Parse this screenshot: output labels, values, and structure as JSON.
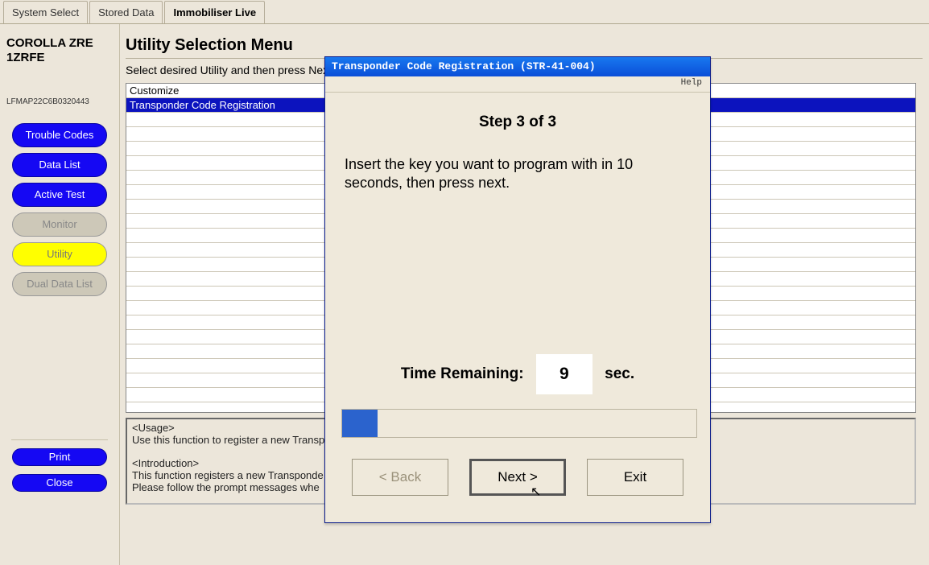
{
  "tabs": {
    "system_select": "System Select",
    "stored_data": "Stored Data",
    "immobiliser_live": "Immobiliser Live"
  },
  "sidebar": {
    "vehicle": "COROLLA ZRE 1ZRFE",
    "map_id": "LFMAP22C6B0320443",
    "buttons": {
      "trouble_codes": "Trouble Codes",
      "data_list": "Data List",
      "active_test": "Active Test",
      "monitor": "Monitor",
      "utility": "Utility",
      "dual_data_list": "Dual Data List"
    },
    "footer": {
      "print": "Print",
      "close": "Close"
    }
  },
  "main": {
    "title": "Utility Selection Menu",
    "subtitle": "Select desired Utility and then press Next",
    "items": [
      "Customize",
      "Transponder Code Registration"
    ],
    "selected_index": 1,
    "usage": {
      "u_hdr": "<Usage>",
      "u_line": "Use this function to register a new Transp",
      "i_hdr": "<Introduction>",
      "i_line1": "This function registers a new Transponde",
      "i_line2": "Please follow the prompt messages whe"
    }
  },
  "dialog": {
    "title": "Transponder Code Registration (STR-41-004)",
    "help": "Help",
    "step": "Step 3 of 3",
    "message": "Insert the key you want to program with in 10 seconds, then press next.",
    "time_label": "Time Remaining:",
    "time_value": "9",
    "time_unit": "sec.",
    "progress_percent": 10,
    "buttons": {
      "back": "< Back",
      "next": "Next >",
      "exit": "Exit"
    }
  }
}
